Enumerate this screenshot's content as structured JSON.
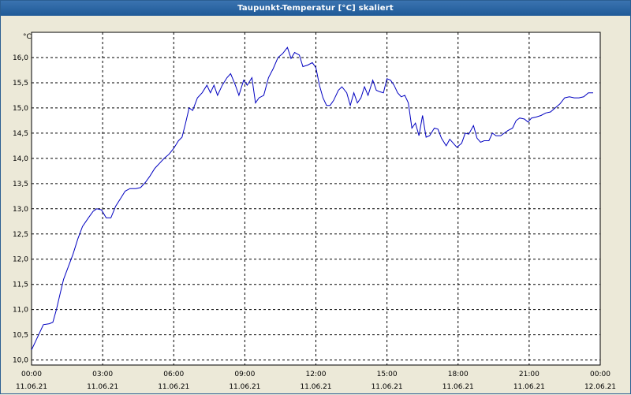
{
  "window": {
    "title": "Taupunkt-Temperatur [°C] skaliert"
  },
  "colors": {
    "series": "#0000c0",
    "plot_bg": "#ffffff",
    "grid": "#000000",
    "titlebar": "#1f5a97"
  },
  "chart_data": {
    "type": "line",
    "title": "Taupunkt-Temperatur [°C] skaliert",
    "ylabel": "°C",
    "ylim": [
      9.9,
      16.5
    ],
    "xlim": [
      0,
      24
    ],
    "grid": true,
    "y_ticks": [
      "10,0",
      "10,5",
      "11,0",
      "11,5",
      "12,0",
      "12,5",
      "13,0",
      "13,5",
      "14,0",
      "14,5",
      "15,0",
      "15,5",
      "16,0"
    ],
    "x_ticks": [
      {
        "time": "00:00",
        "date": "11.06.21"
      },
      {
        "time": "03:00",
        "date": "11.06.21"
      },
      {
        "time": "06:00",
        "date": "11.06.21"
      },
      {
        "time": "09:00",
        "date": "11.06.21"
      },
      {
        "time": "12:00",
        "date": "11.06.21"
      },
      {
        "time": "15:00",
        "date": "11.06.21"
      },
      {
        "time": "18:00",
        "date": "11.06.21"
      },
      {
        "time": "21:00",
        "date": "11.06.21"
      },
      {
        "time": "00:00",
        "date": "12.06.21"
      }
    ],
    "series": [
      {
        "points": [
          [
            0.0,
            10.2
          ],
          [
            0.25,
            10.45
          ],
          [
            0.5,
            10.7
          ],
          [
            0.75,
            10.72
          ],
          [
            0.9,
            10.75
          ],
          [
            1.05,
            11.0
          ],
          [
            1.2,
            11.3
          ],
          [
            1.35,
            11.6
          ],
          [
            1.55,
            11.85
          ],
          [
            1.75,
            12.1
          ],
          [
            1.95,
            12.4
          ],
          [
            2.15,
            12.65
          ],
          [
            2.4,
            12.82
          ],
          [
            2.6,
            12.95
          ],
          [
            2.75,
            13.0
          ],
          [
            2.95,
            12.98
          ],
          [
            3.15,
            12.82
          ],
          [
            3.35,
            12.82
          ],
          [
            3.55,
            13.05
          ],
          [
            3.75,
            13.2
          ],
          [
            3.95,
            13.35
          ],
          [
            4.15,
            13.4
          ],
          [
            4.4,
            13.4
          ],
          [
            4.6,
            13.42
          ],
          [
            4.8,
            13.52
          ],
          [
            5.0,
            13.65
          ],
          [
            5.2,
            13.8
          ],
          [
            5.4,
            13.9
          ],
          [
            5.6,
            14.0
          ],
          [
            5.8,
            14.08
          ],
          [
            6.0,
            14.2
          ],
          [
            6.2,
            14.35
          ],
          [
            6.35,
            14.42
          ],
          [
            6.5,
            14.7
          ],
          [
            6.65,
            15.0
          ],
          [
            6.8,
            14.95
          ],
          [
            7.0,
            15.2
          ],
          [
            7.2,
            15.3
          ],
          [
            7.4,
            15.45
          ],
          [
            7.55,
            15.3
          ],
          [
            7.7,
            15.45
          ],
          [
            7.85,
            15.25
          ],
          [
            8.05,
            15.45
          ],
          [
            8.25,
            15.6
          ],
          [
            8.4,
            15.68
          ],
          [
            8.6,
            15.45
          ],
          [
            8.75,
            15.25
          ],
          [
            8.95,
            15.55
          ],
          [
            9.1,
            15.45
          ],
          [
            9.3,
            15.6
          ],
          [
            9.45,
            15.1
          ],
          [
            9.6,
            15.2
          ],
          [
            9.8,
            15.25
          ],
          [
            10.0,
            15.6
          ],
          [
            10.2,
            15.78
          ],
          [
            10.4,
            16.0
          ],
          [
            10.6,
            16.08
          ],
          [
            10.8,
            16.2
          ],
          [
            10.95,
            15.98
          ],
          [
            11.1,
            16.1
          ],
          [
            11.3,
            16.05
          ],
          [
            11.45,
            15.82
          ],
          [
            11.65,
            15.85
          ],
          [
            11.85,
            15.9
          ],
          [
            12.0,
            15.8
          ],
          [
            12.15,
            15.45
          ],
          [
            12.3,
            15.2
          ],
          [
            12.45,
            15.05
          ],
          [
            12.6,
            15.05
          ],
          [
            12.75,
            15.15
          ],
          [
            12.95,
            15.35
          ],
          [
            13.1,
            15.42
          ],
          [
            13.3,
            15.3
          ],
          [
            13.45,
            15.05
          ],
          [
            13.6,
            15.3
          ],
          [
            13.75,
            15.1
          ],
          [
            13.9,
            15.2
          ],
          [
            14.05,
            15.42
          ],
          [
            14.2,
            15.25
          ],
          [
            14.4,
            15.55
          ],
          [
            14.55,
            15.35
          ],
          [
            14.7,
            15.32
          ],
          [
            14.85,
            15.3
          ],
          [
            15.0,
            15.58
          ],
          [
            15.15,
            15.55
          ],
          [
            15.3,
            15.45
          ],
          [
            15.45,
            15.3
          ],
          [
            15.6,
            15.22
          ],
          [
            15.75,
            15.25
          ],
          [
            15.9,
            15.1
          ],
          [
            16.05,
            14.6
          ],
          [
            16.2,
            14.7
          ],
          [
            16.35,
            14.45
          ],
          [
            16.5,
            14.85
          ],
          [
            16.65,
            14.42
          ],
          [
            16.8,
            14.45
          ],
          [
            17.0,
            14.6
          ],
          [
            17.15,
            14.58
          ],
          [
            17.3,
            14.4
          ],
          [
            17.5,
            14.25
          ],
          [
            17.65,
            14.38
          ],
          [
            17.8,
            14.3
          ],
          [
            17.95,
            14.22
          ],
          [
            18.15,
            14.3
          ],
          [
            18.3,
            14.5
          ],
          [
            18.45,
            14.48
          ],
          [
            18.65,
            14.65
          ],
          [
            18.8,
            14.4
          ],
          [
            18.95,
            14.32
          ],
          [
            19.1,
            14.35
          ],
          [
            19.3,
            14.35
          ],
          [
            19.45,
            14.5
          ],
          [
            19.6,
            14.45
          ],
          [
            19.8,
            14.45
          ],
          [
            19.95,
            14.5
          ],
          [
            20.1,
            14.55
          ],
          [
            20.3,
            14.6
          ],
          [
            20.45,
            14.75
          ],
          [
            20.6,
            14.8
          ],
          [
            20.8,
            14.78
          ],
          [
            20.95,
            14.72
          ],
          [
            21.1,
            14.8
          ],
          [
            21.3,
            14.82
          ],
          [
            21.5,
            14.85
          ],
          [
            21.7,
            14.9
          ],
          [
            21.9,
            14.92
          ],
          [
            22.1,
            15.0
          ],
          [
            22.3,
            15.08
          ],
          [
            22.5,
            15.2
          ],
          [
            22.7,
            15.22
          ],
          [
            22.9,
            15.2
          ],
          [
            23.1,
            15.2
          ],
          [
            23.3,
            15.22
          ],
          [
            23.5,
            15.3
          ],
          [
            23.7,
            15.3
          ]
        ]
      }
    ]
  }
}
